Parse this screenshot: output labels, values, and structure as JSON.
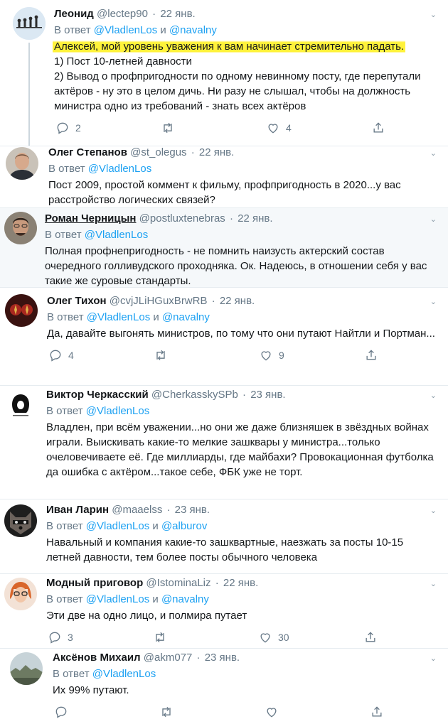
{
  "replying_prefix": "В ответ",
  "and_word": "и",
  "tweets": [
    {
      "name": "Леонид",
      "handle": "@lectep90",
      "date": "22 янв.",
      "reply_to": [
        "@VladlenLos",
        "@navalny"
      ],
      "lines": [
        "Алексей, мой уровень уважения к вам начинает стремительно падать.",
        "1) Пост 10-летней давности",
        "2) Вывод о профпригодности по одному невинному посту, где перепутали актёров - ну это в целом дичь. Ни разу не слышал, чтобы на должность министра одно из требований - знать всех актёров"
      ],
      "reply_count": "2",
      "retweet_count": "",
      "like_count": "4"
    },
    {
      "name": "Олег Степанов",
      "handle": "@st_olegus",
      "date": "22 янв.",
      "reply_to": [
        "@VladlenLos"
      ],
      "lines": [
        "Пост 2009, простой коммент к фильму, профпригодность в 2020...у вас расстройство логических связей?"
      ]
    },
    {
      "name": "Роман Черницын",
      "handle": "@postluxtenebras",
      "date": "22 янв.",
      "reply_to": [
        "@VladlenLos"
      ],
      "lines": [
        "Полная профнепригодность - не помнить наизусть актерский состав очередного голливудского проходняка. Ок. Надеюсь, в отношении себя у вас такие же суровые стандарты."
      ]
    },
    {
      "name": "Олег Тихон",
      "handle": "@cvjJLiHGuxBrwRB",
      "date": "22 янв.",
      "reply_to": [
        "@VladlenLos",
        "@navalny"
      ],
      "lines": [
        "Да, давайте выгонять министров, по тому что они путают Найтли и Портман..."
      ],
      "reply_count": "4",
      "retweet_count": "",
      "like_count": "9"
    },
    {
      "name": "Виктор Черкасский",
      "handle": "@CherkasskySPb",
      "date": "23 янв.",
      "reply_to": [
        "@VladlenLos"
      ],
      "lines": [
        "Владлен, при всём уважении...но они же даже близняшек в звёздных войнах играли. Выискивать какие-то мелкие зашквары у министра...только очеловечиваете её. Где миллиарды, где майбахи? Провокационная футболка да ошибка с актёром...такое себе, ФБК уже не торт."
      ]
    },
    {
      "name": "Иван Ларин",
      "handle": "@maaelss",
      "date": "23 янв.",
      "reply_to": [
        "@VladlenLos",
        "@alburov"
      ],
      "lines": [
        "Навальный и компания какие-то зашквартные, наезжать за посты 10-15 летней давности, тем более посты обычного человека"
      ]
    },
    {
      "name": "Модный приговор",
      "handle": "@IstominaLiz",
      "date": "22 янв.",
      "reply_to": [
        "@VladlenLos",
        "@navalny"
      ],
      "lines": [
        "Эти две на одно лицо, и полмира путает"
      ],
      "reply_count": "3",
      "retweet_count": "",
      "like_count": "30"
    },
    {
      "name": "Аксёнов Михаил",
      "handle": "@akm077",
      "date": "23 янв.",
      "reply_to": [
        "@VladlenLos"
      ],
      "lines": [
        "Их 99% путают."
      ],
      "reply_count": "",
      "retweet_count": "",
      "like_count": ""
    }
  ]
}
